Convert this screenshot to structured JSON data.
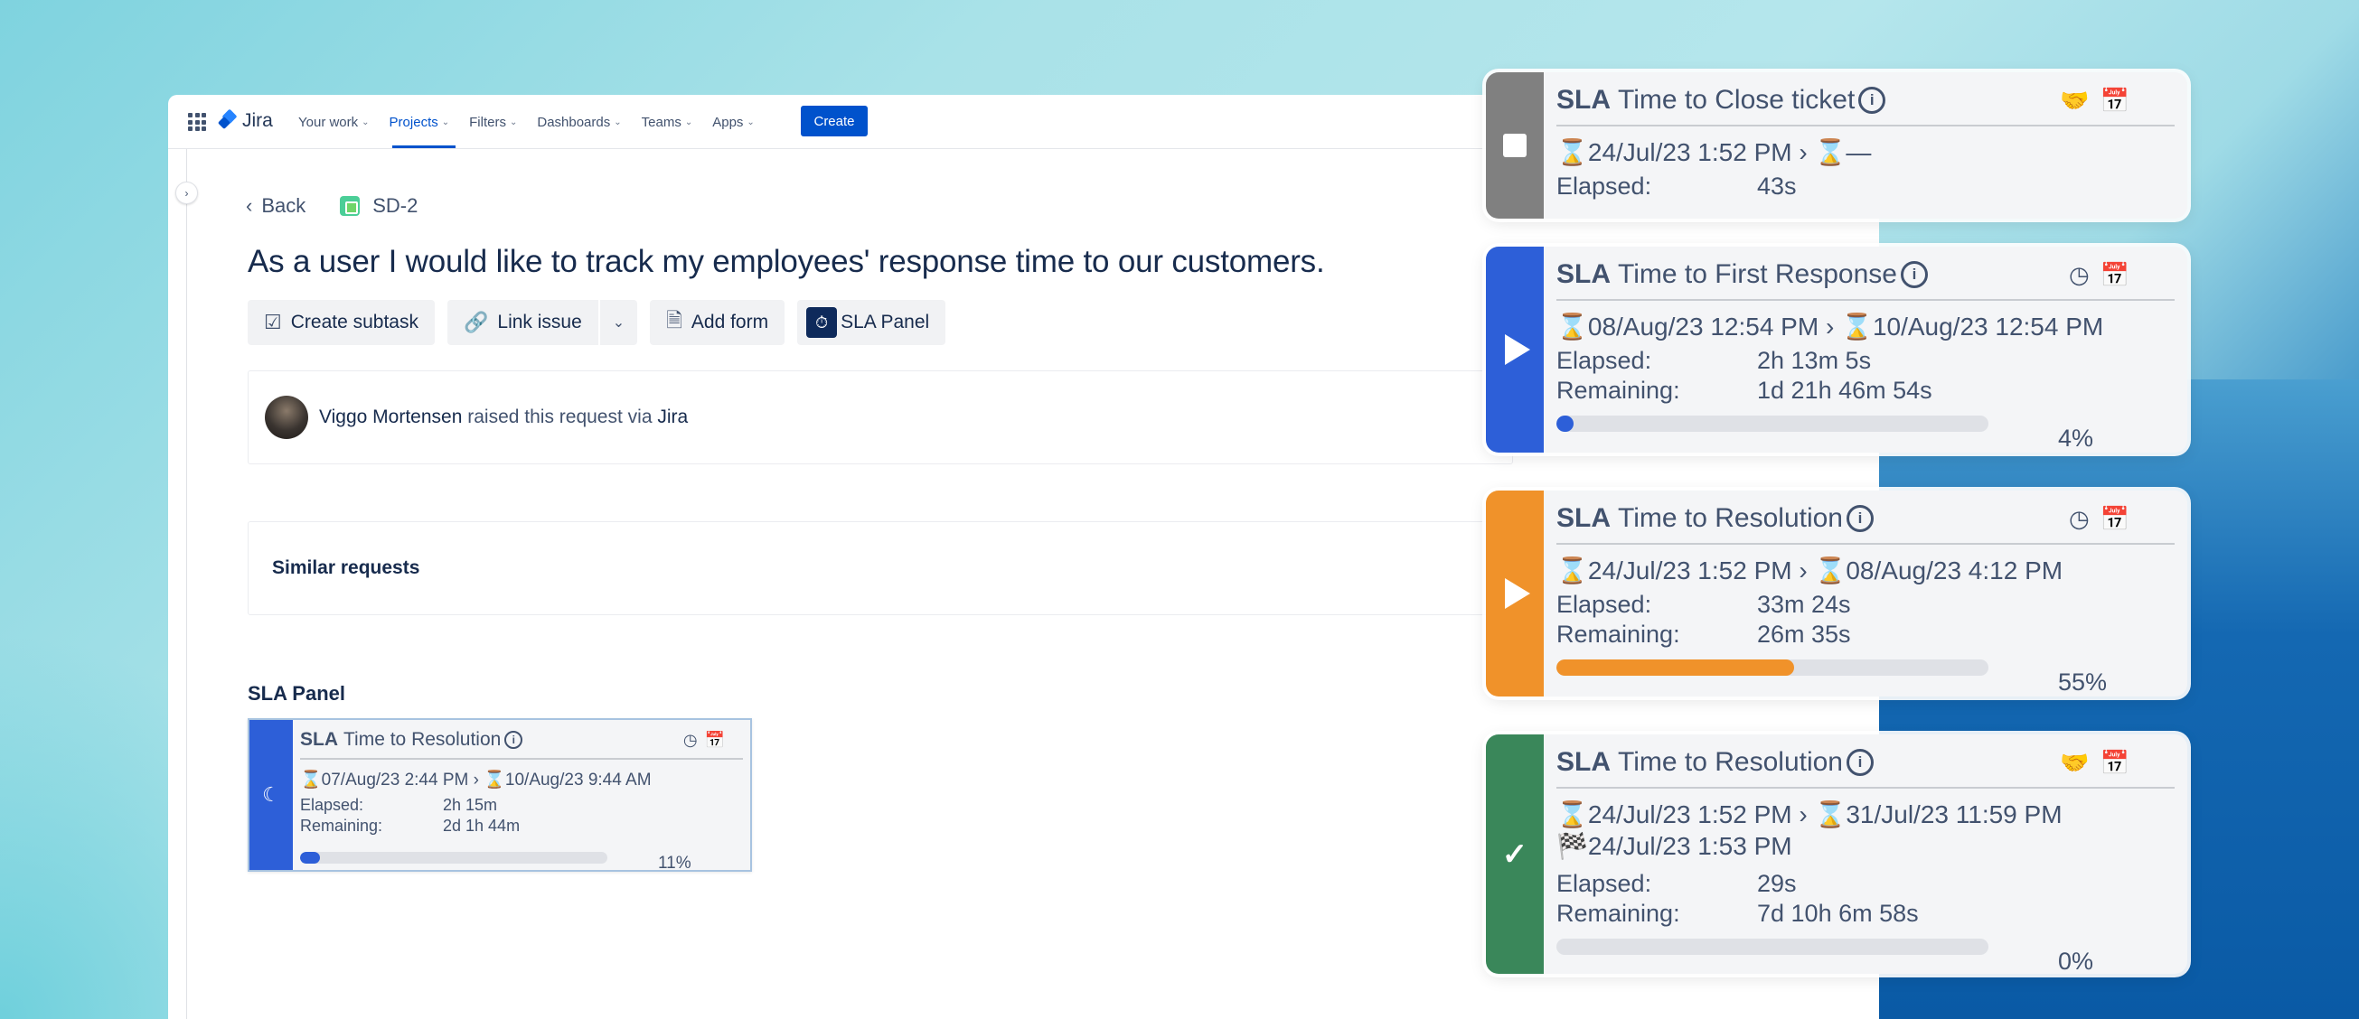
{
  "nav": {
    "logo": "Jira",
    "items": [
      {
        "label": "Your work"
      },
      {
        "label": "Projects"
      },
      {
        "label": "Filters"
      },
      {
        "label": "Dashboards"
      },
      {
        "label": "Teams"
      },
      {
        "label": "Apps"
      }
    ],
    "create_label": "Create"
  },
  "issue": {
    "back_label": "Back",
    "key": "SD-2",
    "title": "As a user I would like to track my employees' response time to our customers.",
    "actions": {
      "create_subtask": "Create subtask",
      "link_issue": "Link issue",
      "add_form": "Add form",
      "sla_panel": "SLA Panel"
    },
    "reporter": {
      "name": "Viggo Mortensen",
      "text": "raised this request via",
      "channel": "Jira"
    },
    "similar_requests": "Similar requests",
    "sla_panel_title": "SLA Panel"
  },
  "small_sla": {
    "prefix": "SLA",
    "name": "Time to Resolution",
    "start": "07/Aug/23 2:44 PM",
    "end": "10/Aug/23 9:44 AM",
    "elapsed_label": "Elapsed:",
    "elapsed": "2h 15m",
    "remaining_label": "Remaining:",
    "remaining": "2d 1h 44m",
    "percent": "11%",
    "progress": 0.11,
    "color": "#2d5fd8"
  },
  "cards": [
    {
      "prefix": "SLA",
      "name": "Time to Close ticket",
      "state": "stopped",
      "color": "#808080",
      "start": "24/Jul/23 1:52 PM",
      "end": "—",
      "elapsed_label": "Elapsed:",
      "elapsed": "43s"
    },
    {
      "prefix": "SLA",
      "name": "Time to First Response",
      "state": "running",
      "color": "#2d5fd8",
      "start": "08/Aug/23 12:54 PM",
      "end": "10/Aug/23 12:54 PM",
      "elapsed_label": "Elapsed:",
      "elapsed": "2h 13m 5s",
      "remaining_label": "Remaining:",
      "remaining": "1d 21h 46m 54s",
      "percent": "4%",
      "progress": 0.04
    },
    {
      "prefix": "SLA",
      "name": "Time to Resolution",
      "state": "running",
      "color": "#f0922a",
      "start": "24/Jul/23 1:52 PM",
      "end": "08/Aug/23 4:12 PM",
      "elapsed_label": "Elapsed:",
      "elapsed": "33m 24s",
      "remaining_label": "Remaining:",
      "remaining": "26m 35s",
      "percent": "55%",
      "progress": 0.55
    },
    {
      "prefix": "SLA",
      "name": "Time to Resolution",
      "state": "met",
      "color": "#3a875a",
      "start": "24/Jul/23 1:52 PM",
      "end": "31/Jul/23 11:59 PM",
      "finished": "24/Jul/23 1:53 PM",
      "elapsed_label": "Elapsed:",
      "elapsed": "29s",
      "remaining_label": "Remaining:",
      "remaining": "7d 10h 6m 58s",
      "percent": "0%",
      "progress": 0
    }
  ]
}
